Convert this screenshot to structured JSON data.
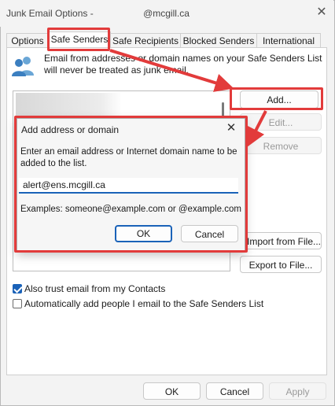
{
  "window": {
    "title": "Junk Email Options -",
    "title_email": "@mcgill.ca",
    "close_glyph": "✕"
  },
  "tabs": [
    {
      "label": "Options",
      "active": false
    },
    {
      "label": "Safe Senders",
      "active": true
    },
    {
      "label": "Safe Recipients",
      "active": false
    },
    {
      "label": "Blocked Senders",
      "active": false
    },
    {
      "label": "International",
      "active": false
    }
  ],
  "panel": {
    "icon": "people-icon",
    "description": "Email from addresses or domain names on your Safe Senders List will never be treated as junk email.",
    "buttons": {
      "add": "Add...",
      "edit": "Edit...",
      "remove": "Remove",
      "import": "Import from File...",
      "export": "Export to File..."
    },
    "checkboxes": [
      {
        "label": "Also trust email from my Contacts",
        "checked": true
      },
      {
        "label": "Automatically add people I email to the Safe Senders List",
        "checked": false
      }
    ]
  },
  "footer": {
    "ok": "OK",
    "cancel": "Cancel",
    "apply": "Apply"
  },
  "dialog": {
    "title": "Add address or domain",
    "close_glyph": "✕",
    "instructions": "Enter an email address or Internet domain name to be added to the list.",
    "input_value": "alert@ens.mcgill.ca",
    "examples": "Examples: someone@example.com or @example.com",
    "ok": "OK",
    "cancel": "Cancel"
  },
  "colors": {
    "accent": "#1a62b8",
    "annotation": "#e23b3b"
  }
}
